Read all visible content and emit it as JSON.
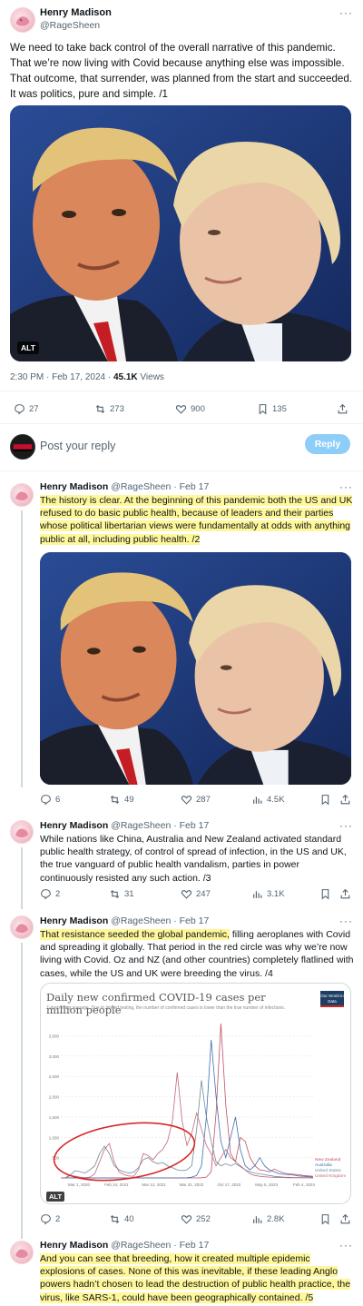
{
  "main_tweet": {
    "author_name": "Henry Madison",
    "author_handle": "@RageSheen",
    "text": "We need to take back control of the overall narrative of this pandemic. That we’re now living with Covid because anything else was impossible. That outcome, that surrender, was planned from the start and succeeded. It was politics, pure and simple. /1",
    "image_alt_badge": "ALT",
    "time": "2:30 PM · Feb 17, 2024 · ",
    "views_count": "45.1K",
    "views_label": " Views",
    "replies": "27",
    "retweets": "273",
    "likes": "900",
    "bookmarks": "135"
  },
  "composer": {
    "placeholder": "Post your reply",
    "reply_button": "Reply"
  },
  "replies": [
    {
      "author_name": "Henry Madison",
      "author_handle": "@RageSheen · Feb 17",
      "text": "The history is clear. At the beginning of this pandemic both the US and UK refused to do basic public health, because of leaders and their parties whose political libertarian views were fundamentally at odds with anything public at all, including public health. /2",
      "replies": "6",
      "retweets": "49",
      "likes": "287",
      "views": "4.5K"
    },
    {
      "author_name": "Henry Madison",
      "author_handle": "@RageSheen · Feb 17",
      "text": "While nations like China, Australia and New Zealand activated standard public health strategy, of control of spread of infection, in the US and UK, the true vanguard of public health vandalism, parties in power continuously resisted any such action. /3",
      "replies": "2",
      "retweets": "31",
      "likes": "247",
      "views": "3.1K"
    },
    {
      "author_name": "Henry Madison",
      "author_handle": "@RageSheen · Feb 17",
      "text_highlight": "That resistance seeded the global pandemic,",
      "text_rest": " filling aeroplanes with Covid and spreading it globally. That period in the red circle was why we’re now living with Covid. Oz and NZ (and other countries) completely flatlined with cases, while the US and UK were breeding the virus. /4",
      "replies": "2",
      "retweets": "40",
      "likes": "252",
      "views": "2.8K",
      "chart_alt_badge": "ALT"
    },
    {
      "author_name": "Henry Madison",
      "author_handle": "@RageSheen · Feb 17",
      "text": "And you can see that breeding, how it created multiple epidemic explosions of cases. None of this was inevitable, if these leading Anglo powers hadn’t chosen to lead the destruction of public health practice, the virus, like SARS-1, could have been geographically contained. /5"
    }
  ],
  "chart_data": {
    "type": "line",
    "title": "Daily new confirmed COVID-19 cases per million people",
    "subtitle": "7-day rolling average. Due to limited testing, the number of confirmed cases is lower than the true number of infections.",
    "logo": "Our World in Data",
    "x_ticks": [
      "Mar 1, 2020",
      "Feb 24, 2021",
      "Mar 12, 2021",
      "Mar 31, 2022",
      "Oct 17, 2022",
      "May 5, 2023",
      "Feb 4, 2024"
    ],
    "y_ticks": [
      "500",
      "1,000",
      "1,500",
      "2,000",
      "2,500",
      "3,000",
      "3,500"
    ],
    "ylim": [
      0,
      3800
    ],
    "series": [
      {
        "name": "New Zealand",
        "color": "#c15065",
        "values": [
          0,
          0,
          0,
          0,
          0,
          0,
          0,
          0,
          0,
          0,
          0,
          0,
          0,
          0,
          0,
          0,
          0,
          0,
          0,
          0,
          0,
          0,
          0,
          0,
          0,
          0,
          0,
          0,
          0,
          5,
          20,
          150,
          1600,
          3800,
          1800,
          600,
          400,
          1000,
          900,
          500,
          300,
          200,
          180,
          150,
          220,
          160,
          120,
          100,
          90,
          80,
          60,
          50,
          40
        ]
      },
      {
        "name": "Australia",
        "color": "#3d6fb4",
        "values": [
          0,
          0,
          0,
          0,
          0,
          0,
          0,
          0,
          0,
          0,
          0,
          0,
          0,
          0,
          0,
          0,
          0,
          0,
          0,
          0,
          0,
          0,
          0,
          0,
          0,
          0,
          5,
          20,
          60,
          300,
          1500,
          3400,
          2000,
          900,
          500,
          1000,
          1500,
          700,
          300,
          200,
          300,
          500,
          300,
          200,
          150,
          100,
          90,
          80,
          70,
          50,
          40,
          30,
          20
        ]
      },
      {
        "name": "United States",
        "color": "#6d8a9c",
        "values": [
          0,
          10,
          80,
          180,
          150,
          120,
          200,
          300,
          600,
          780,
          600,
          300,
          200,
          150,
          120,
          140,
          250,
          450,
          500,
          400,
          350,
          380,
          300,
          250,
          200,
          180,
          200,
          300,
          1200,
          2400,
          1500,
          900,
          400,
          300,
          350,
          300,
          350,
          280,
          200,
          150,
          120,
          100,
          80,
          60,
          40,
          30,
          20,
          15,
          10,
          8,
          5,
          5,
          5
        ]
      },
      {
        "name": "United Kingdom",
        "color": "#c4677a",
        "values": [
          0,
          5,
          60,
          40,
          20,
          10,
          20,
          100,
          400,
          700,
          850,
          400,
          150,
          80,
          50,
          40,
          200,
          600,
          550,
          450,
          600,
          700,
          900,
          1400,
          2600,
          1400,
          800,
          1100,
          1600,
          1200,
          800,
          600,
          300,
          500,
          700,
          500,
          400,
          300,
          200,
          100,
          60,
          40,
          30,
          20,
          15,
          10,
          8,
          5,
          5,
          5,
          5,
          5,
          5
        ]
      }
    ]
  }
}
